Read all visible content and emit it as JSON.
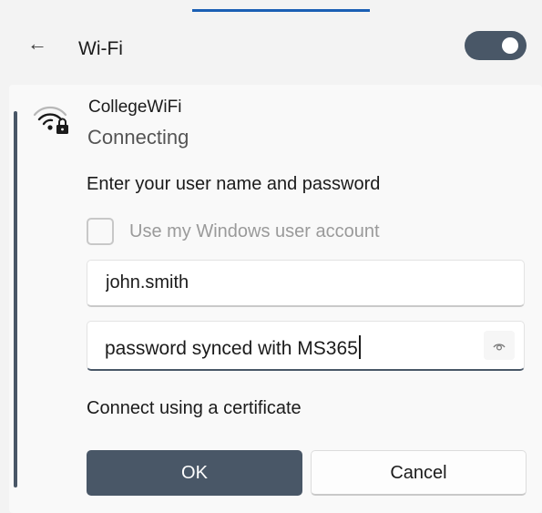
{
  "header": {
    "back_icon": "arrow-left-icon",
    "title": "Wi-Fi",
    "wifi_toggle_on": true,
    "accent_color": "#495767"
  },
  "network": {
    "icon": "wifi-locked-icon",
    "name": "CollegeWiFi",
    "status": "Connecting"
  },
  "auth": {
    "prompt": "Enter your user name and password",
    "use_windows_account_label": "Use my Windows user account",
    "use_windows_account_checked": false,
    "username_value": "john.smith",
    "password_value": "password synced with MS365",
    "reveal_icon": "eye-icon",
    "certificate_link": "Connect using a certificate"
  },
  "buttons": {
    "ok": "OK",
    "cancel": "Cancel"
  }
}
